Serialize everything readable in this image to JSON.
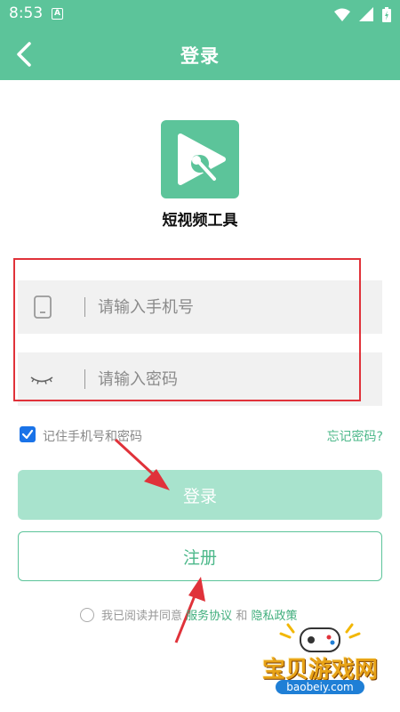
{
  "status_bar": {
    "time": "8:53",
    "notif_icon": "A"
  },
  "header": {
    "title": "登录",
    "back_icon": "chevron-left-icon"
  },
  "app": {
    "name": "短视频工具",
    "logo_color": "#5cc49a"
  },
  "form": {
    "phone": {
      "placeholder": "请输入手机号",
      "value": "",
      "icon": "phone-icon"
    },
    "password": {
      "placeholder": "请输入密码",
      "value": "",
      "icon": "eye-closed-icon"
    },
    "remember_label": "记住手机号和密码",
    "remember_checked": true,
    "forgot_label": "忘记密码?"
  },
  "buttons": {
    "login_label": "登录",
    "register_label": "注册"
  },
  "agreement": {
    "prefix": "我已阅读并同意",
    "service_link": "服务协议",
    "and": "和",
    "privacy_link": "隐私政策"
  },
  "watermark": {
    "title": "宝贝游戏网",
    "url": "baobeiy.com"
  },
  "colors": {
    "primary": "#5cc49a",
    "login_disabled": "#a8e3cd",
    "annotation": "#e0323a",
    "link": "#3fae7c"
  }
}
